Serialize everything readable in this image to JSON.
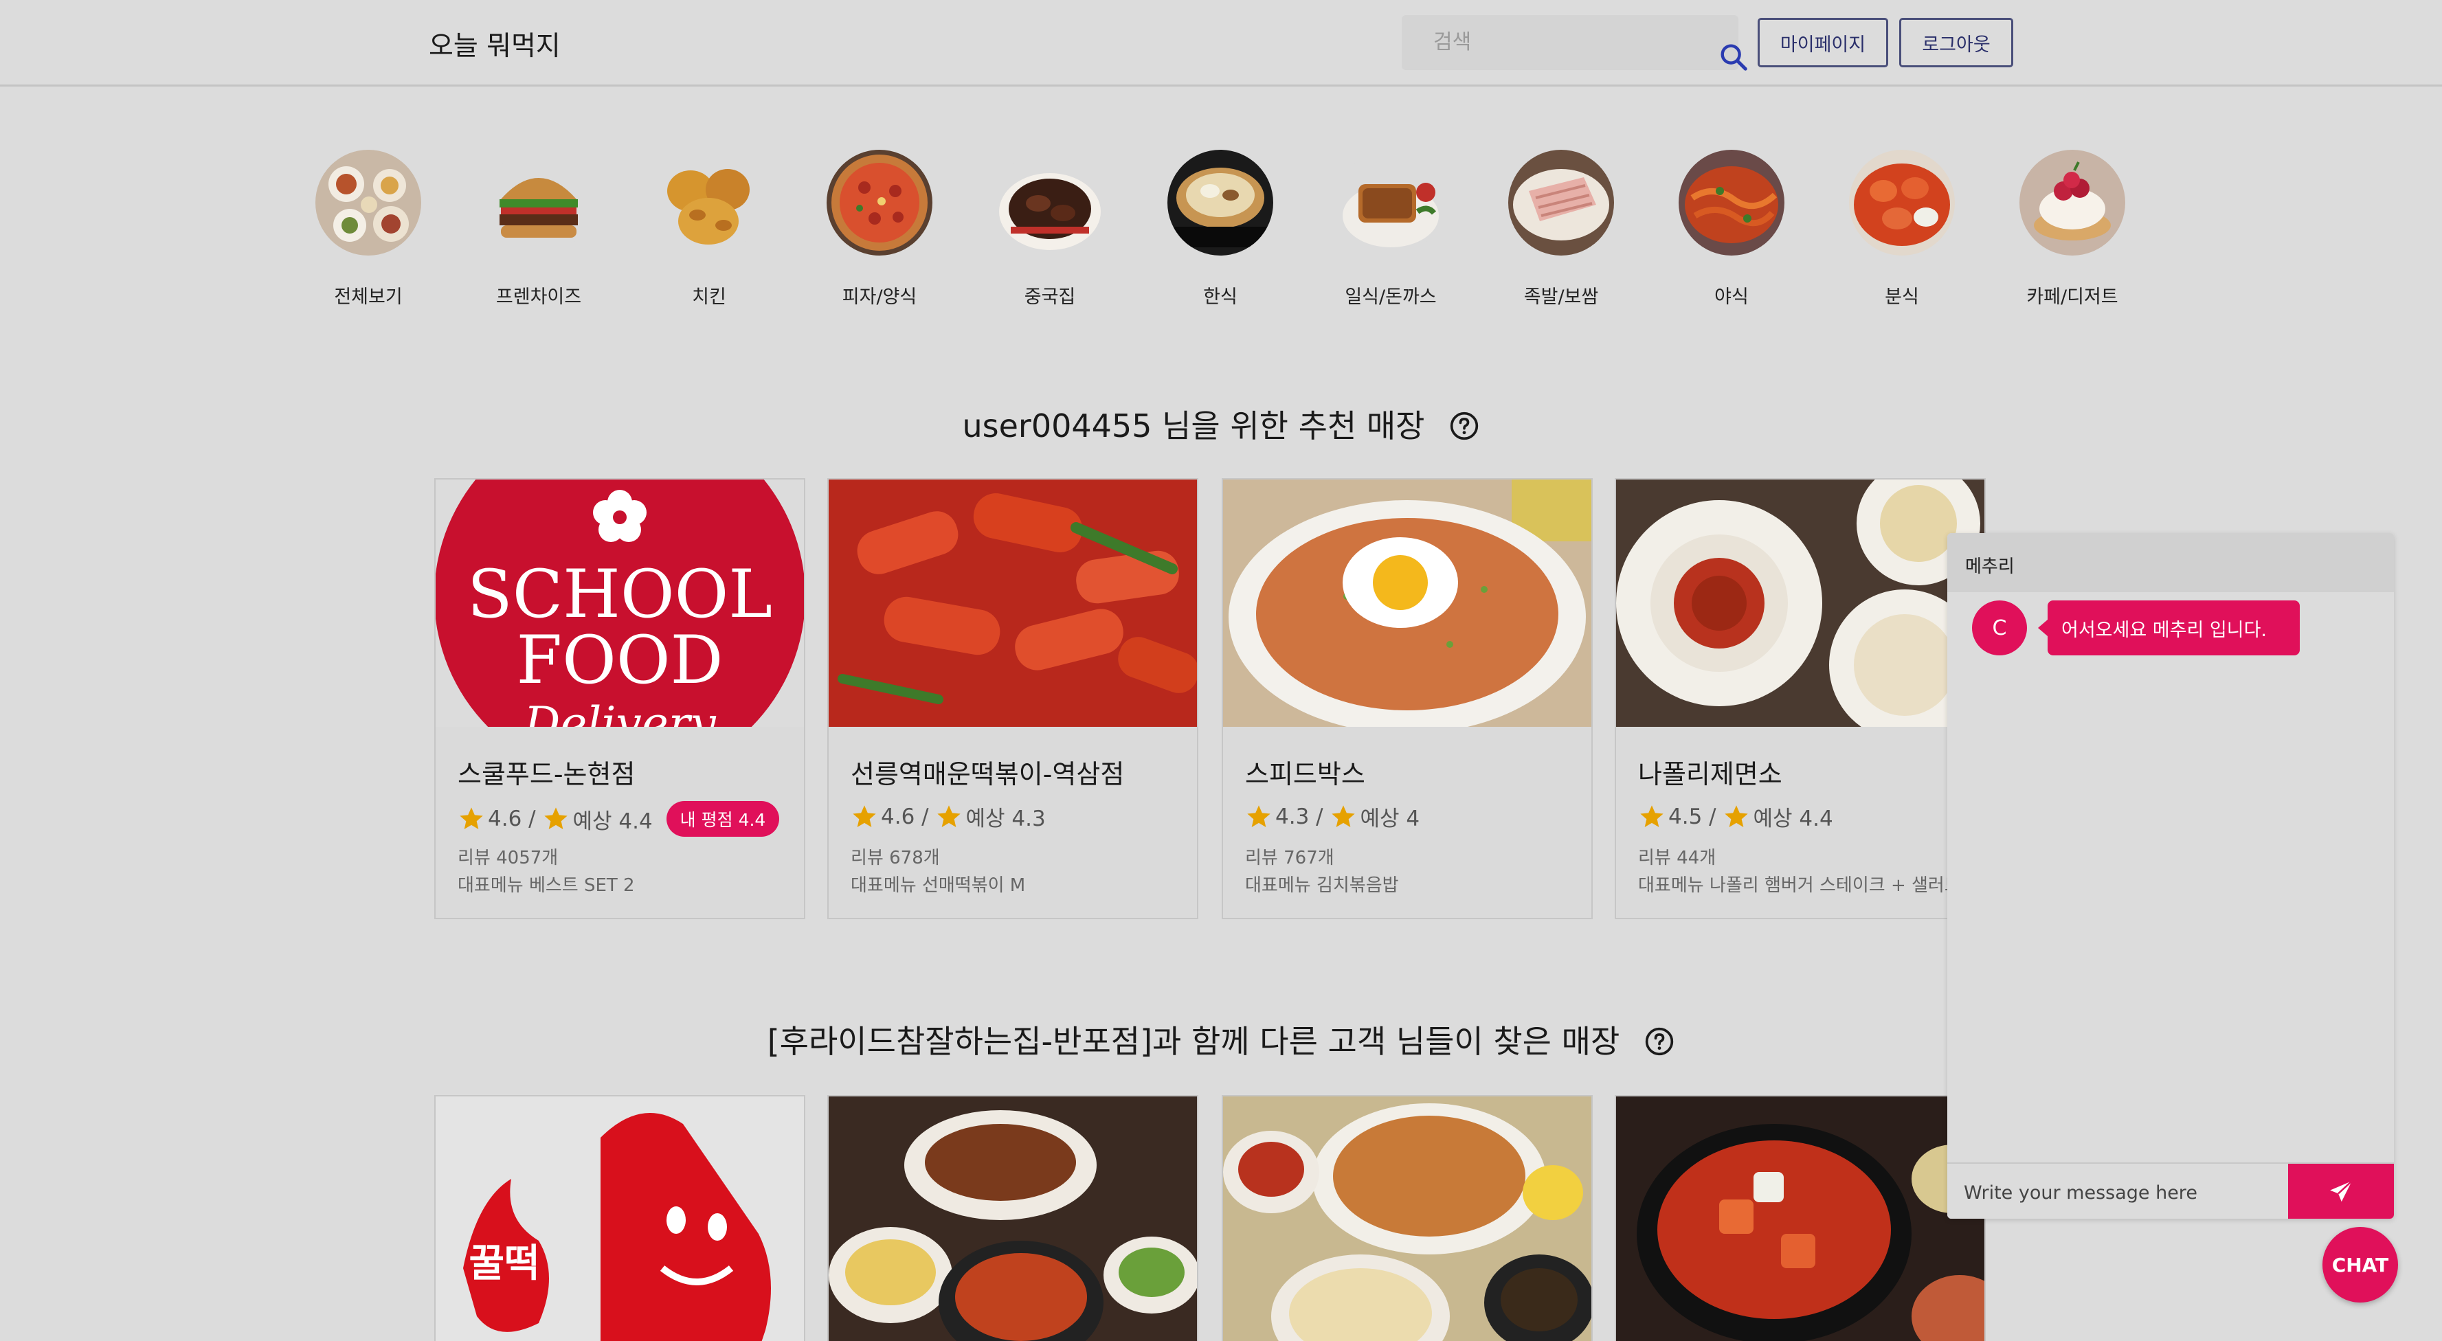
{
  "header": {
    "logo": "오늘 뭐먹지",
    "search_placeholder": "검색",
    "mypage_label": "마이페이지",
    "logout_label": "로그아웃"
  },
  "categories": [
    {
      "label": "전체보기"
    },
    {
      "label": "프렌차이즈"
    },
    {
      "label": "치킨"
    },
    {
      "label": "피자/양식"
    },
    {
      "label": "중국집"
    },
    {
      "label": "한식"
    },
    {
      "label": "일식/돈까스"
    },
    {
      "label": "족발/보쌈"
    },
    {
      "label": "야식"
    },
    {
      "label": "분식"
    },
    {
      "label": "카페/디저트"
    }
  ],
  "section1": {
    "title": "user004455 님을 위한 추천 매장",
    "cards": [
      {
        "name": "스쿨푸드-논현점",
        "rating": "4.6",
        "expected": "예상 4.4",
        "badge": "내 평점 4.4",
        "reviews": "리뷰 4057개",
        "menu": "대표메뉴 베스트 SET 2"
      },
      {
        "name": "선릉역매운떡볶이-역삼점",
        "rating": "4.6",
        "expected": "예상 4.3",
        "reviews": "리뷰 678개",
        "menu": "대표메뉴 선매떡볶이 M"
      },
      {
        "name": "스피드박스",
        "rating": "4.3",
        "expected": "예상 4",
        "reviews": "리뷰 767개",
        "menu": "대표메뉴 김치볶음밥"
      },
      {
        "name": "나폴리제면소",
        "rating": "4.5",
        "expected": "예상 4.4",
        "reviews": "리뷰 44개",
        "menu": "대표메뉴 나폴리 햄버거 스테이크 + 샐러드"
      }
    ]
  },
  "section2": {
    "title": "[후라이드참잘하는집-반포점]과 함께 다른 고객 님들이 찾은 매장"
  },
  "chat": {
    "title": "메추리",
    "avatar_letter": "C",
    "message": "어서오세요 메추리 입니다.",
    "input_placeholder": "Write your message here",
    "fab_label": "CHAT"
  },
  "logo_texts": {
    "schoolfood_line1": "SCHOOL",
    "schoolfood_line2": "FOOD",
    "schoolfood_line3": "Delivery",
    "kkultteok": "꿀떡"
  },
  "colors": {
    "accent": "#e0105a",
    "background": "#dcdcdc",
    "star": "#e6a100",
    "button_border": "#4a4f7a"
  },
  "separator": " / "
}
